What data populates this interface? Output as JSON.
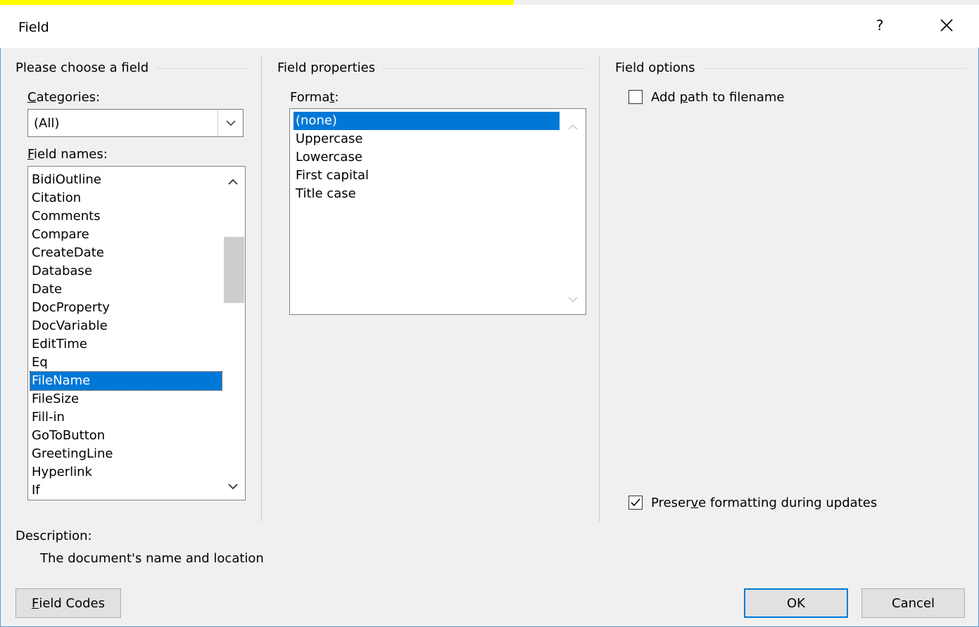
{
  "dialog": {
    "title": "Field",
    "help_label": "?"
  },
  "choose_field": {
    "group_title": "Please choose a field",
    "categories_label_mnemonic": "C",
    "categories_label_rest": "ategories:",
    "categories_value": "(All)",
    "field_names_label_mnemonic": "F",
    "field_names_label_rest": "ield names:",
    "field_names": [
      "BidiOutline",
      "Citation",
      "Comments",
      "Compare",
      "CreateDate",
      "Database",
      "Date",
      "DocProperty",
      "DocVariable",
      "EditTime",
      "Eq",
      "FileName",
      "FileSize",
      "Fill-in",
      "GoToButton",
      "GreetingLine",
      "Hyperlink",
      "If"
    ],
    "selected_field": "FileName"
  },
  "field_properties": {
    "group_title": "Field properties",
    "format_label_before": "Forma",
    "format_label_mnemonic": "t",
    "format_label_after": ":",
    "formats": [
      "(none)",
      "Uppercase",
      "Lowercase",
      "First capital",
      "Title case"
    ],
    "selected_format": "(none)"
  },
  "field_options": {
    "group_title": "Field options",
    "add_path": {
      "before": "Add ",
      "mnemonic": "p",
      "after": "ath to filename",
      "checked": false
    },
    "preserve": {
      "before": "Preser",
      "mnemonic": "v",
      "after": "e formatting during updates",
      "checked": true
    }
  },
  "description": {
    "label": "Description:",
    "text": "The document's name and location"
  },
  "buttons": {
    "field_codes_mnemonic": "F",
    "field_codes_rest": "ield Codes",
    "ok": "OK",
    "cancel": "Cancel"
  },
  "colors": {
    "selection": "#0078d7",
    "window_border": "#5b9bd5",
    "highlight": "#ffff00"
  }
}
